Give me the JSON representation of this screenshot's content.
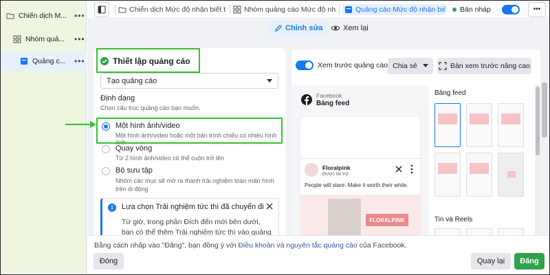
{
  "nav": {
    "items": [
      {
        "label": "Chiến dịch M..."
      },
      {
        "label": "Nhóm quả..."
      },
      {
        "label": "Quảng c..."
      }
    ],
    "more": "•••"
  },
  "topbar": {
    "crumb1": "Chiến dịch Mức độ nhận biết t",
    "crumb2": "Nhóm quảng cáo Mức độ nhậ",
    "crumb3": "Quảng cáo Mức độ nhận biết",
    "status": "Bản nháp",
    "more": "•••"
  },
  "tabs": {
    "edit": "Chỉnh sửa",
    "review": "Xem lại"
  },
  "setup": {
    "title": "Thiết lập quảng cáo",
    "select_value": "Tạo quảng cáo",
    "format_heading": "Định dạng",
    "format_desc": "Chọn cấu trúc quảng cáo bạn muốn.",
    "options": [
      {
        "title": "Một hình ảnh/video",
        "desc": "Một hình ảnh/video hoặc một bản trình chiếu có nhiều hình ảnh",
        "selected": true
      },
      {
        "title": "Quay vòng",
        "desc": "Từ 2 hình ảnh/video có thể cuộn trở lên",
        "selected": false
      },
      {
        "title": "Bộ sưu tập",
        "desc": "Nhóm các mục sẽ mở ra thành trải nghiệm toàn màn hình trên di động",
        "selected": false
      }
    ],
    "notice_title": "Lựa chọn Trải nghiệm tức thì đã chuyển đi",
    "notice_body": "Từ giờ, trong phần Đích đến mới bên dưới, bạn có thể thêm Trải nghiệm tức thì vào quảng cáo của"
  },
  "preview": {
    "toggle_label": "Xem trước quảng cáo",
    "share_label": "Chia sẻ",
    "advanced_label": "Bản xem trước nâng cao",
    "platform": "Facebook",
    "placement": "Bảng feed",
    "page_name": "Floralpink",
    "sponsored": "Được tài trợ ·",
    "post_text": "People will stare. Make it worth their while.",
    "banner_text": "FLORALPINK",
    "feed_heading": "Bảng feed",
    "reels_heading": "Tin và Reels"
  },
  "footer": {
    "consent_prefix": "Bằng cách nhấp vào \"Đăng\", bạn đồng ý với ",
    "consent_link": "Điều khoản và nguyên tắc quảng cáo",
    "consent_suffix": " của Facebook.",
    "close": "Đóng",
    "back": "Quay lại",
    "publish": "Đăng"
  },
  "colors": {
    "accent": "#1877f2",
    "highlight": "#31c32b",
    "publish": "#31a24c"
  }
}
